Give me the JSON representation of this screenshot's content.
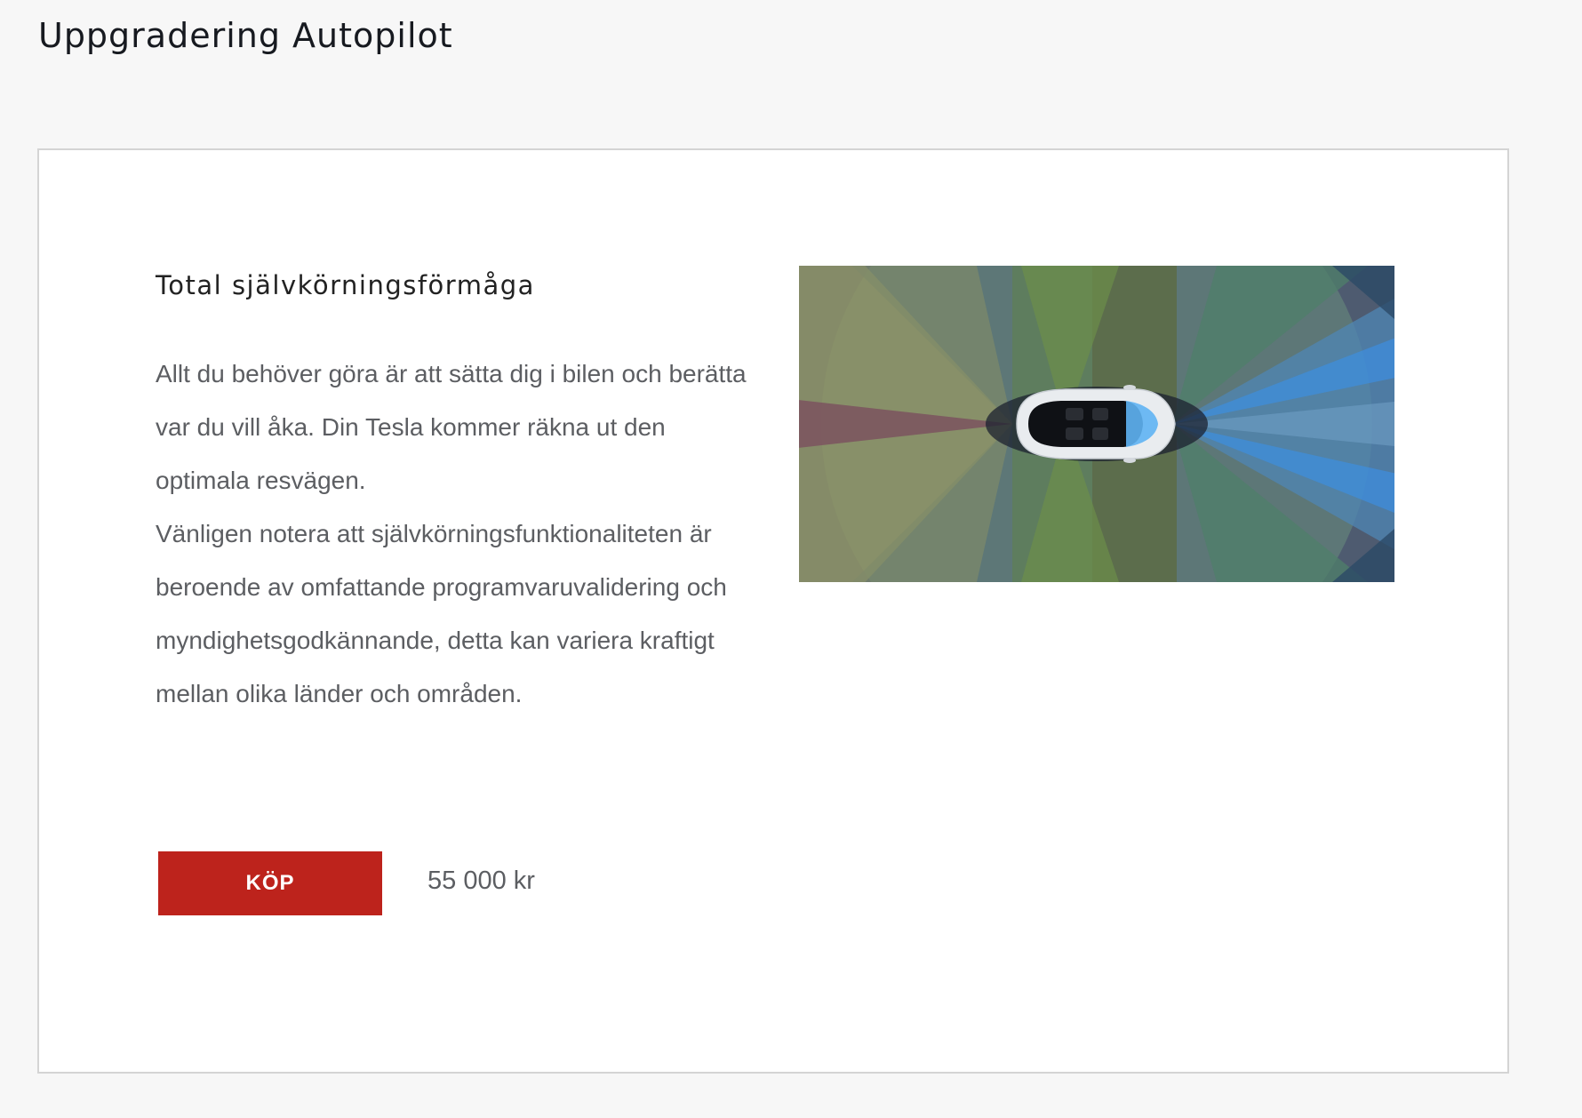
{
  "page": {
    "title": "Uppgradering Autopilot"
  },
  "feature": {
    "title": "Total självkörningsförmåga",
    "description_paragraphs": [
      "Allt du behöver göra är att sätta dig i bilen och berätta var du vill åka. Din Tesla kommer räkna ut den optimala resvägen.",
      "Vänligen notera att självkörningsfunktionaliteten är beroende av omfattande programvaruvalidering och myndighetsgodkännande, detta kan variera kraftigt mellan olika länder och områden."
    ],
    "buy_label": "KÖP",
    "price": "55 000 kr",
    "illustration": "autopilot-sensor-coverage-image"
  },
  "colors": {
    "accent": "#bd231c",
    "background": "#f7f7f7",
    "card": "#ffffff"
  }
}
